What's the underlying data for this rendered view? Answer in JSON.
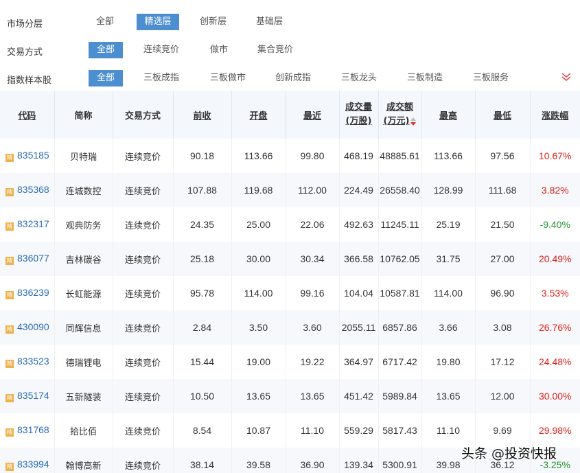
{
  "filters": {
    "market_tier": {
      "label": "市场分层",
      "options": [
        "全部",
        "精选层",
        "创新层",
        "基础层"
      ],
      "selected": "精选层"
    },
    "trade_mode": {
      "label": "交易方式",
      "options": [
        "全部",
        "连续竞价",
        "做市",
        "集合竞价"
      ],
      "selected": "全部"
    },
    "index_sample": {
      "label": "指数样本股",
      "options": [
        "全部",
        "三板成指",
        "三板做市",
        "创新成指",
        "三板龙头",
        "三板制造",
        "三板服务"
      ],
      "selected": "全部"
    },
    "expand_icon": "double-chevron-down-icon"
  },
  "table": {
    "headers": {
      "code": "代码",
      "name": "简称",
      "mode": "交易方式",
      "prev_close": "前收",
      "open": "开盘",
      "last": "最近",
      "volume_line1": "成交量",
      "volume_line2": "(万股)",
      "amount_line1": "成交额",
      "amount_line2": "(万元)",
      "high": "最高",
      "low": "最低",
      "change": "涨跌幅"
    },
    "badge_text": "精",
    "rows": [
      {
        "code": "835185",
        "name": "贝特瑞",
        "mode": "连续竞价",
        "prev": "90.18",
        "open": "113.66",
        "last": "99.80",
        "volume": "468.19",
        "amount": "48885.61",
        "high": "113.66",
        "low": "97.56",
        "change": "10.67%",
        "dir": "up"
      },
      {
        "code": "835368",
        "name": "连城数控",
        "mode": "连续竞价",
        "prev": "107.88",
        "open": "119.68",
        "last": "112.00",
        "volume": "224.49",
        "amount": "26558.40",
        "high": "128.99",
        "low": "111.68",
        "change": "3.82%",
        "dir": "up"
      },
      {
        "code": "832317",
        "name": "观典防务",
        "mode": "连续竞价",
        "prev": "24.35",
        "open": "25.00",
        "last": "22.06",
        "volume": "492.63",
        "amount": "11245.11",
        "high": "25.19",
        "low": "21.50",
        "change": "-9.40%",
        "dir": "down"
      },
      {
        "code": "836077",
        "name": "吉林碳谷",
        "mode": "连续竞价",
        "prev": "25.18",
        "open": "30.00",
        "last": "30.34",
        "volume": "366.58",
        "amount": "10762.05",
        "high": "31.75",
        "low": "27.00",
        "change": "20.49%",
        "dir": "up"
      },
      {
        "code": "836239",
        "name": "长虹能源",
        "mode": "连续竞价",
        "prev": "95.78",
        "open": "114.00",
        "last": "99.16",
        "volume": "104.04",
        "amount": "10587.81",
        "high": "114.00",
        "low": "96.90",
        "change": "3.53%",
        "dir": "up"
      },
      {
        "code": "430090",
        "name": "同辉信息",
        "mode": "连续竞价",
        "prev": "2.84",
        "open": "3.50",
        "last": "3.60",
        "volume": "2055.11",
        "amount": "6857.86",
        "high": "3.66",
        "low": "3.08",
        "change": "26.76%",
        "dir": "up"
      },
      {
        "code": "833523",
        "name": "德瑞锂电",
        "mode": "连续竞价",
        "prev": "15.44",
        "open": "19.00",
        "last": "19.22",
        "volume": "364.97",
        "amount": "6717.42",
        "high": "19.80",
        "low": "17.12",
        "change": "24.48%",
        "dir": "up"
      },
      {
        "code": "835174",
        "name": "五新隧装",
        "mode": "连续竞价",
        "prev": "10.50",
        "open": "13.65",
        "last": "13.65",
        "volume": "451.42",
        "amount": "5989.84",
        "high": "13.65",
        "low": "12.00",
        "change": "30.00%",
        "dir": "up"
      },
      {
        "code": "831768",
        "name": "拾比佰",
        "mode": "连续竞价",
        "prev": "8.54",
        "open": "10.87",
        "last": "11.10",
        "volume": "559.29",
        "amount": "5817.43",
        "high": "11.10",
        "low": "9.69",
        "change": "29.98%",
        "dir": "up"
      },
      {
        "code": "833994",
        "name": "翰博高新",
        "mode": "连续竞价",
        "prev": "38.14",
        "open": "39.58",
        "last": "36.90",
        "volume": "139.34",
        "amount": "5300.91",
        "high": "39.98",
        "low": "36.12",
        "change": "-3.25%",
        "dir": "down"
      }
    ]
  },
  "colors": {
    "accent": "#4d8ed0",
    "up": "#e0201a",
    "down": "#22922c",
    "code_link": "#2b6cb8",
    "badge": "#f0b04a"
  },
  "watermark": "头条 @投资快报"
}
